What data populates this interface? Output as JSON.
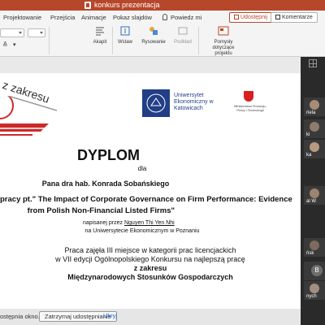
{
  "titlebar": {
    "doc_title": "konkurs prezentacja"
  },
  "ribbon": {
    "tabs": [
      "Projektowanie",
      "Przejścia",
      "Animacje",
      "Pokaz slajdów",
      "Powiedz mi"
    ],
    "share_label": "Udostępnij",
    "comments_label": "Komentarze",
    "groups": [
      {
        "label": "Akapit",
        "icon": "paragraph-icon"
      },
      {
        "label": "Wstaw",
        "icon": "insert-icon"
      },
      {
        "label": "Rysowanie",
        "icon": "drawing-icon"
      },
      {
        "label": "Podkład",
        "icon": "designer-icon"
      },
      {
        "label": "Pomysły dotyczące projektu",
        "icon": "design-ideas-icon"
      }
    ]
  },
  "slide": {
    "logo_text": "z zakresu",
    "uni_name": "Uniwersytet Ekonomiczny w Katowicach",
    "ministry_name": "Ministerstwo Rozwoju, Pracy i Technologii",
    "title": "DYPLOM",
    "for": "dla",
    "recipient": "Pana dra hab. Konrada Sobańskiego",
    "thesis_line1": "pracy pt.\" The Impact of Corporate Governance on Firm Performance: Evidence",
    "thesis_line2": "from Polish Non-Financial Listed Firms\"",
    "written_prefix": "napisanej przez",
    "author": "Nguyen Thi Yen Nhi",
    "university": "na Uniwersytecie Ekonomicznym w Poznaniu",
    "line1": "Praca zajęła III miejsce w kategorii prac licencjackich",
    "line2": "w VII edycji Ogólnopolskiego Konkursu na najlepszą pracę",
    "line3": "z zakresu",
    "line4": "Międzynarodowych Stosunków Gospodarczych"
  },
  "participants": [
    {
      "name": "riela",
      "kind": "face"
    },
    {
      "name": "ki",
      "kind": "face"
    },
    {
      "name": "ka",
      "kind": "face"
    },
    {
      "name": "al W",
      "kind": "face"
    },
    {
      "name": "ńsk",
      "kind": "face"
    },
    {
      "name": "B",
      "kind": "initial"
    },
    {
      "name": "nych",
      "kind": "face"
    }
  ],
  "bottombar": {
    "notice": "ostępnia okno.",
    "stop_label": "Zatrzymaj udostępnianie",
    "hide_label": "Ukryj"
  },
  "colors": {
    "brand": "#b7472a",
    "uni_blue": "#223e87"
  }
}
